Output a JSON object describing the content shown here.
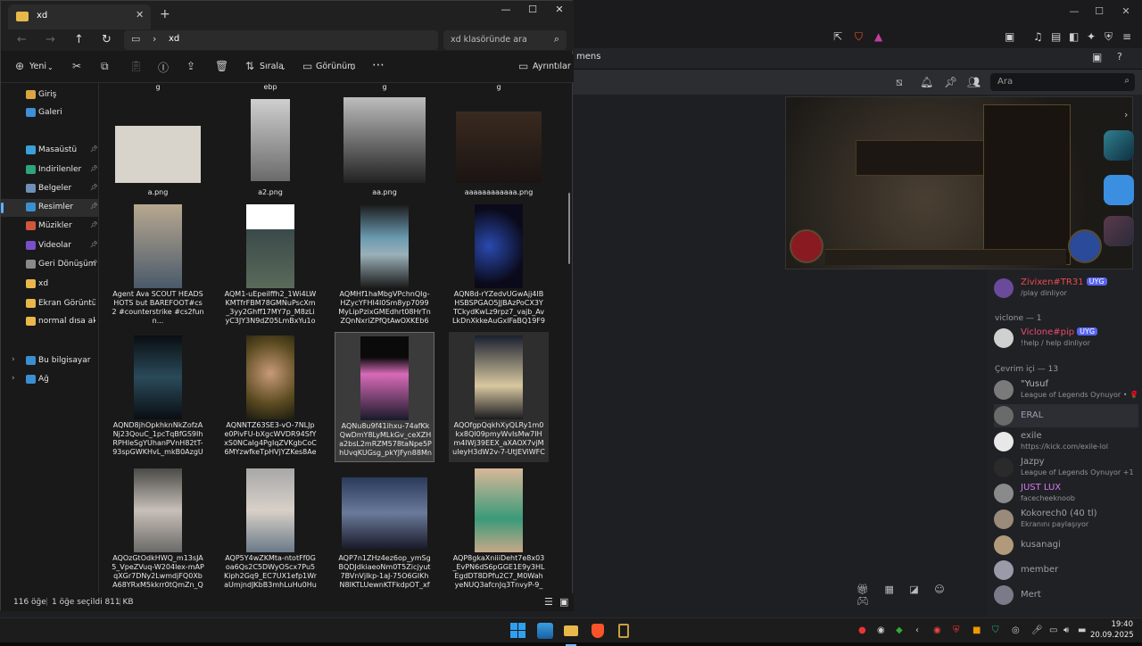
{
  "explorer": {
    "tab_title": "xd",
    "path_current": "xd",
    "search_placeholder": "xd klasöründe ara",
    "toolbar": {
      "new_label": "Yeni",
      "sort_label": "Sırala",
      "view_label": "Görünüm",
      "details_label": "Ayrıntılar"
    },
    "sidebar": [
      {
        "label": "Giriş",
        "color": "#d9a63f",
        "pinned": false
      },
      {
        "label": "Galeri",
        "color": "#3f8fd9",
        "pinned": false
      },
      {
        "label": "Masaüstü",
        "color": "#3aa0d8",
        "pinned": true
      },
      {
        "label": "İndirilenler",
        "color": "#2fa37a",
        "pinned": true
      },
      {
        "label": "Belgeler",
        "color": "#6f8fb8",
        "pinned": true
      },
      {
        "label": "Resimler",
        "color": "#3a8fd0",
        "pinned": true
      },
      {
        "label": "Müzikler",
        "color": "#d2563e",
        "pinned": true
      },
      {
        "label": "Videolar",
        "color": "#7b4fc9",
        "pinned": true
      },
      {
        "label": "Geri Dönüşüm K",
        "color": "#8a8a8a",
        "pinned": true
      },
      {
        "label": "xd",
        "color": "#e8b84a",
        "pinned": false
      },
      {
        "label": "Ekran Görüntüleri",
        "color": "#e8b84a",
        "pinned": false
      },
      {
        "label": "normal dısa aktarm",
        "color": "#e8b84a",
        "pinned": false
      },
      {
        "label": "Bu bilgisayar",
        "color": "#3a8fd0",
        "pinned": false
      },
      {
        "label": "Ağ",
        "color": "#3a8fd0",
        "pinned": false
      }
    ],
    "top_captions": [
      "g",
      "ebp",
      "g",
      "g"
    ],
    "files": [
      {
        "name": "a.png"
      },
      {
        "name": "a2.png"
      },
      {
        "name": "aa.png"
      },
      {
        "name": "aaaaaaaaaaaa.png"
      },
      {
        "name": "Agent Ava SCOUT HEADSHOTS but BAREFOOT#cs2 #counterstrike #cs2funn..."
      },
      {
        "name": "AQM1-uEpeiIffh2_1Wi4LWKMTfrFBM78GMNuPscXm_3yy2Ghff17MY7p_M8zLiyC3JY3N9dZ05LmBxYu1o4VWp7WU..."
      },
      {
        "name": "AQMHf1haMbgVPchnQIg-HZycYFHI4I0Sm8yp7099MyLipPzixGMEdhrt08HrTnZQnNxriZPfQtAwOXKEb6EBknDF6y..."
      },
      {
        "name": "AQN8d-rYZedvUGwAjj4IBHSBSPGAO5JJBAzPoCX3YTCkydKwLz9rpz7_vajb_AvLkDnXkkeAuGxIFaBQ19F9jzUlI61SK..."
      },
      {
        "name": "AQND8jhOpkhknNkZofzANj23QouC_1pcTqBfGS9IhRPHIeSgYUhanPVnH82tT-93spGWKHvL_mkB0AzgU0UADQ54..."
      },
      {
        "name": "AQNNTZ63SE3-vO-7NLJpe0PivFU-bXgcWVDR94SfYxS0NCaIg4PgIqZVKgbCoC6MYzwfkeTpHVjYZKes8Ae7WbZv..."
      },
      {
        "name": "AQNu8u9f41ihxu-74afKkQwDmY8LyMLkGv_ceXZHa2bsL2mRZM578taNpe5PhUvqKUGsg_pkYJFyn88MnNB2FbLr..."
      },
      {
        "name": "AQOfgpQqkhXyQLRy1m0kx8QI09pmyWvIsMw7IHm4IWj39EEX_aXAOX7vjMuIeyH3dW2v-7-UtJEViWFCvqdpswn..."
      },
      {
        "name": "AQOzGtOdkHWQ_m13sJA5_VpeZVuq-W204lex-mAPqXGr7DNy2LwmdjFQ0XbA68YRxM5kkrr0tQmZn_QNIj3JZiJk..."
      },
      {
        "name": "AQP5Y4wZKMta-ntotFf0Goa6Qs2C5DWyOScx7Pu5Kiph2Gq9_EC7UX1efp1WraUmjndJKbB3mhLuHu0HuZmdZj5..."
      },
      {
        "name": "AQP7n1ZHz4ez6op_ymSgBQDJdkiaeoNm0T5Zicjyut7BVnVjIkp-1aJ-75O6GIKhN8IKTLUewnKTFkdpOT_xfZ1F9aMjf..."
      },
      {
        "name": "AQP8gkaXniiiDeht7e8x03_EvPN6dS6pGGE1E9y3HLEgdDT8DPfu2C7_M0WahyeNUQ3afcnJq3TnvyP-9_R4KX4QVZJ..."
      }
    ],
    "status": {
      "count": "116 öğe",
      "selected": "1 öğe seçildi 811 KB"
    }
  },
  "browser": {
    "topbar_text": "mens",
    "search_placeholder": "Ara"
  },
  "members": {
    "playing_header": "viclone — 1",
    "online_header": "Çevrim içi — 13",
    "list_top": [
      {
        "name": "Zivixen#TR31",
        "badge": "UYG",
        "status": "/play dinliyor",
        "color": "#e94b4b"
      },
      {
        "name": "Viclone#pip",
        "badge": "UYG",
        "status": "!help / help dinliyor",
        "color": "#e94b6b"
      }
    ],
    "list": [
      {
        "name": "\"Yusuf",
        "status": "League of Legends Oynuyor • 🌹",
        "color": "#b0b4ba"
      },
      {
        "name": "ERAL",
        "status": "",
        "color": "#9aa0a8"
      },
      {
        "name": "exile",
        "status": "https://kick.com/exile-lol",
        "color": "#9aa0a8"
      },
      {
        "name": "Jazpy",
        "status": "League of Legends Oynuyor +1",
        "color": "#9aa0a8"
      },
      {
        "name": "JUST LUX",
        "status": "facecheeknoob",
        "color": "#d67bf0"
      },
      {
        "name": "Kokorech0 (40 tl)",
        "status": "Ekranını paylaşıyor",
        "color": "#9aa0a8"
      },
      {
        "name": "kusanagi",
        "status": "",
        "color": "#9aa0a8"
      },
      {
        "name": "member",
        "status": "",
        "color": "#9aa0a8"
      },
      {
        "name": "Mert",
        "status": "",
        "color": "#9aa0a8"
      }
    ]
  },
  "taskbar": {
    "time": "19:40",
    "date": "20.09.2025"
  }
}
